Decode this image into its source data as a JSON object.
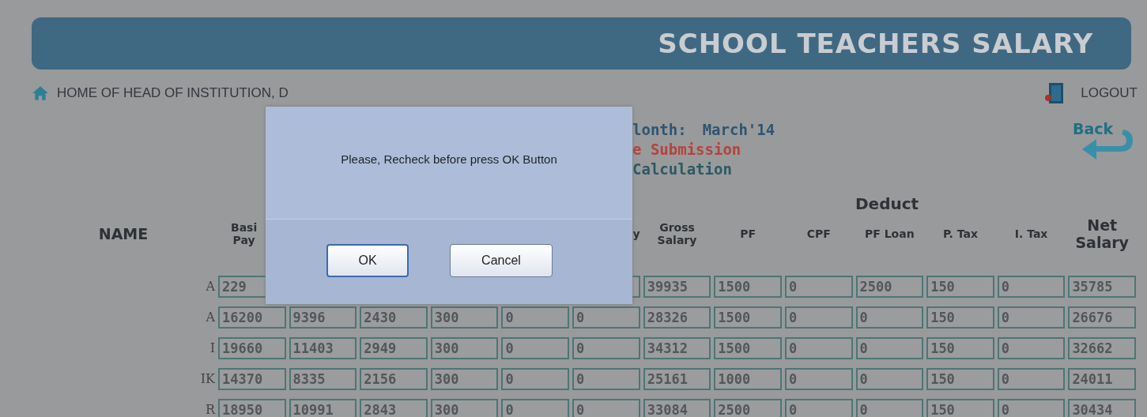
{
  "header": {
    "title": "SCHOOL TEACHERS SALARY"
  },
  "nav": {
    "home": "HOME OF HEAD OF INSTITUTION, D",
    "logout": "LOGOUT",
    "back": "Back"
  },
  "info": [
    {
      "kind": "month",
      "label": "lonth:",
      "value": "March'14"
    },
    {
      "kind": "alert",
      "label": "e Submission"
    },
    {
      "kind": "note",
      "label": "Calculation"
    }
  ],
  "table": {
    "group_header": "Deduct",
    "columns": [
      {
        "lines": [
          "NAME"
        ],
        "kind": "big"
      },
      {
        "lines": [
          "Basi",
          "Pay"
        ],
        "kind": "small"
      },
      {
        "kind": "small"
      },
      {
        "kind": "small"
      },
      {
        "kind": "small"
      },
      {
        "kind": "small"
      },
      {
        "lines": [
          "y"
        ],
        "kind": "small"
      },
      {
        "lines": [
          "Gross",
          "Salary"
        ],
        "kind": "small"
      },
      {
        "lines": [
          "PF"
        ],
        "kind": "small"
      },
      {
        "lines": [
          "CPF"
        ],
        "kind": "small"
      },
      {
        "lines": [
          "PF Loan"
        ],
        "kind": "small"
      },
      {
        "lines": [
          "P. Tax"
        ],
        "kind": "small"
      },
      {
        "lines": [
          "I. Tax"
        ],
        "kind": "small"
      },
      {
        "lines": [
          "Net",
          "Salary"
        ],
        "kind": "big"
      }
    ],
    "rows": [
      {
        "cells": [
          "A",
          "229",
          "",
          "",
          "",
          "",
          "",
          "39935",
          "1500",
          "0",
          "2500",
          "150",
          "0",
          "35785"
        ]
      },
      {
        "cells": [
          "A",
          "16200",
          "9396",
          "2430",
          "300",
          "0",
          "0",
          "28326",
          "1500",
          "0",
          "0",
          "150",
          "0",
          "26676"
        ]
      },
      {
        "cells": [
          "I",
          "19660",
          "11403",
          "2949",
          "300",
          "0",
          "0",
          "34312",
          "1500",
          "0",
          "0",
          "150",
          "0",
          "32662"
        ]
      },
      {
        "cells": [
          "IK",
          "14370",
          "8335",
          "2156",
          "300",
          "0",
          "0",
          "25161",
          "1000",
          "0",
          "0",
          "150",
          "0",
          "24011"
        ]
      },
      {
        "cells": [
          "R",
          "18950",
          "10991",
          "2843",
          "300",
          "0",
          "0",
          "33084",
          "2500",
          "0",
          "0",
          "150",
          "0",
          "30434"
        ]
      }
    ]
  },
  "dialog": {
    "message": "Please, Recheck before press OK Button",
    "buttons": [
      "OK",
      "Cancel"
    ]
  }
}
